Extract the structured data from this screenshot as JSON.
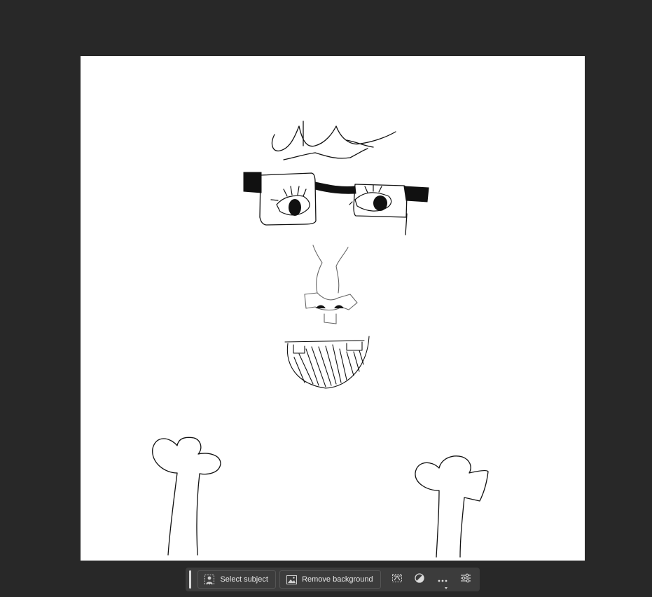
{
  "canvas": {
    "background": "#ffffff",
    "artwork": "face-doodle"
  },
  "taskbar": {
    "select_subject_label": "Select subject",
    "remove_background_label": "Remove background",
    "icons": [
      "person-select-icon",
      "image-icon",
      "transform-icon",
      "adjustment-circle-icon",
      "more-icon",
      "sliders-icon"
    ]
  },
  "colors": {
    "workspace_bg": "#282828",
    "taskbar_bg": "#3c3c3c",
    "taskbar_text": "#e8e8e8",
    "ink": "#111111"
  }
}
